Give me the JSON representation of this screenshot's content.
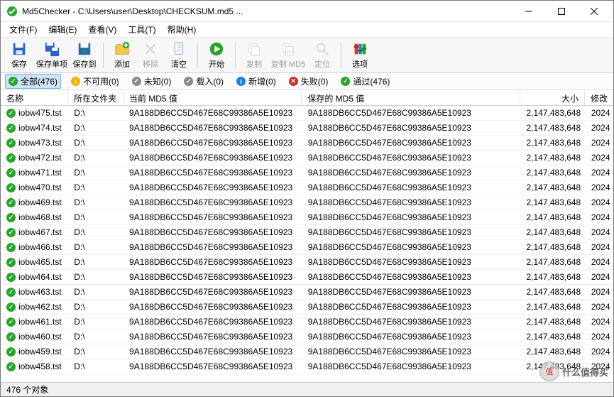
{
  "title": "Md5Checker - C:\\Users\\user\\Desktop\\CHECKSUM.md5 ...",
  "menus": [
    "文件(F)",
    "编辑(E)",
    "查看(V)",
    "工具(T)",
    "帮助(H)"
  ],
  "toolbar": [
    {
      "name": "save",
      "label": "保存",
      "disabled": false
    },
    {
      "name": "save-one",
      "label": "保存单项",
      "disabled": false
    },
    {
      "name": "save-to",
      "label": "保存到",
      "disabled": false
    },
    {
      "sep": true
    },
    {
      "name": "add",
      "label": "添加",
      "disabled": false
    },
    {
      "name": "remove",
      "label": "移除",
      "disabled": true
    },
    {
      "name": "clear",
      "label": "清空",
      "disabled": false
    },
    {
      "sep": true
    },
    {
      "name": "start",
      "label": "开始",
      "disabled": false
    },
    {
      "sep": true
    },
    {
      "name": "copy",
      "label": "复制",
      "disabled": true
    },
    {
      "name": "copy-md5",
      "label": "复制 MD5",
      "disabled": true
    },
    {
      "name": "locate",
      "label": "定位",
      "disabled": true
    },
    {
      "sep": true
    },
    {
      "name": "options",
      "label": "选项",
      "disabled": false
    }
  ],
  "filters": [
    {
      "name": "all",
      "label": "全部(476)",
      "icon": "green",
      "active": true
    },
    {
      "name": "na",
      "label": "不可用(0)",
      "icon": "yellow",
      "active": false
    },
    {
      "name": "unknown",
      "label": "未知(0)",
      "icon": "gray",
      "active": false
    },
    {
      "name": "loaded",
      "label": "载入(0)",
      "icon": "gray",
      "active": false
    },
    {
      "name": "new",
      "label": "新增(0)",
      "icon": "blue",
      "active": false
    },
    {
      "name": "failed",
      "label": "失败(0)",
      "icon": "red",
      "active": false
    },
    {
      "name": "passed",
      "label": "通过(476)",
      "icon": "green",
      "active": false
    }
  ],
  "columns": {
    "name": "名称",
    "folder": "所在文件夹",
    "md5c": "当前 MD5 值",
    "md5s": "保存的 MD5 值",
    "size": "大小",
    "mod": "修改"
  },
  "md5": "9A188DB6CC5D467E68C99386A5E10923",
  "folder": "D:\\",
  "size": "2,147,483,648",
  "mod": "2024",
  "files": [
    "iobw475.tst",
    "iobw474.tst",
    "iobw473.tst",
    "iobw472.tst",
    "iobw471.tst",
    "iobw470.tst",
    "iobw469.tst",
    "iobw468.tst",
    "iobw467.tst",
    "iobw466.tst",
    "iobw465.tst",
    "iobw464.tst",
    "iobw463.tst",
    "iobw462.tst",
    "iobw461.tst",
    "iobw460.tst",
    "iobw459.tst",
    "iobw458.tst"
  ],
  "status": "476 个对象",
  "watermark": "什么值得买"
}
